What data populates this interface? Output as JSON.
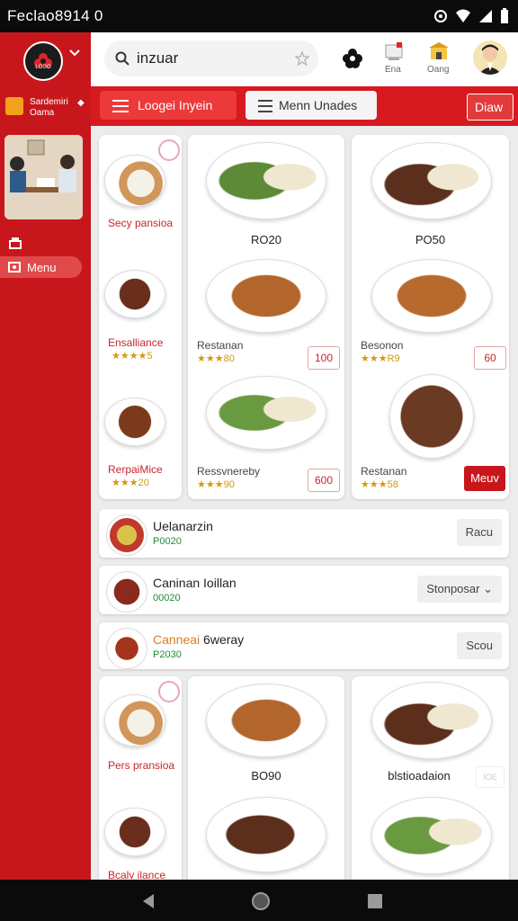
{
  "status_bar": {
    "time": "Feclao8914 0",
    "icons": [
      "sync-icon",
      "wifi-icon",
      "signal-icon",
      "battery-icon"
    ]
  },
  "sidebar": {
    "logo_text": "LOGO",
    "store_name": "Sardemiri",
    "store_sub": "Oama",
    "menu_label": "Menu"
  },
  "header": {
    "search_value": "inzuar",
    "action_labels": {
      "a1": "Ena",
      "a2": "Oang"
    }
  },
  "toolbar": {
    "btn_primary": "Loogei Inyein",
    "btn_secondary": "Menn Unades",
    "btn_right": "Diaw"
  },
  "cards": {
    "left1": {
      "items": [
        {
          "label": "Secy pansioa"
        },
        {
          "label": "Ensalliance",
          "stars": "★★★★5"
        },
        {
          "label": "RerpaiMice",
          "stars": "★★★20"
        }
      ]
    },
    "mid1": {
      "items": [
        {
          "label": "RO20"
        },
        {
          "label": "Restanan",
          "stars": "★★★80",
          "price": "100"
        },
        {
          "label": "Ressvnereby",
          "stars": "★★★90",
          "price": "600"
        }
      ]
    },
    "right1": {
      "items": [
        {
          "label": "PO50"
        },
        {
          "label": "Besonon",
          "stars": "★★★R9",
          "price": "60"
        },
        {
          "label": "Restanan",
          "stars": "★★★58",
          "button": "Meuv"
        }
      ]
    }
  },
  "rows": [
    {
      "title": "Uelanarzin",
      "price": "P0020",
      "button": "Racu"
    },
    {
      "title": "Caninan Ioillan",
      "price": "00020",
      "button": "Stonposar"
    },
    {
      "title_prefix": "Canneai",
      "title": "6weray",
      "price": "P2030",
      "button": "Scou"
    }
  ],
  "cards2": {
    "left2": {
      "items": [
        {
          "label": "Pers pransioa"
        },
        {
          "label": "Bcalv ilance"
        }
      ]
    },
    "mid2": {
      "items": [
        {
          "label": "BO90"
        }
      ]
    },
    "right2": {
      "items": [
        {
          "label": "blstioadaion",
          "price": "IOE"
        }
      ]
    }
  },
  "colors": {
    "brand_red": "#c8171c",
    "bar_red": "#d71920",
    "accent_yellow": "#f2a31b",
    "price_green": "#1f8d3a"
  }
}
